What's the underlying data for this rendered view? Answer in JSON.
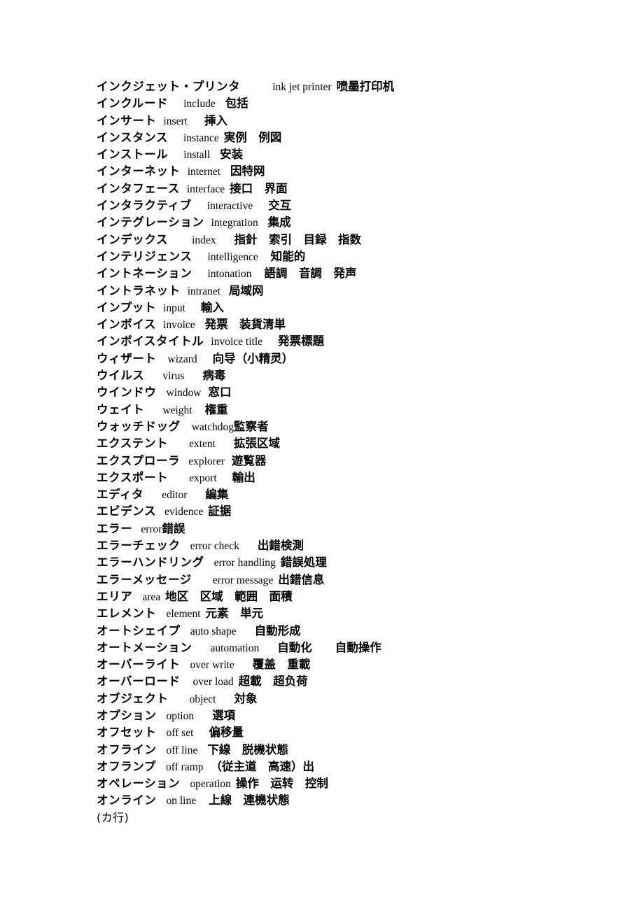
{
  "document": {
    "page_background": "#ffffff",
    "text_color": "#000000",
    "script_kind": "katakana-glossary",
    "columns": [
      "katakana",
      "english",
      "chinese_glosses"
    ]
  },
  "entries": [
    {
      "jp": "インクジェット・プリンタ",
      "gap1": 46,
      "en": "ink jet printer",
      "gap2": 7,
      "cn": "喷墨打印机"
    },
    {
      "jp": "インクルード",
      "gap1": 22,
      "en": "include",
      "gap2": 14,
      "cn": "包括"
    },
    {
      "jp": "インサート",
      "gap1": 10,
      "en": "insert",
      "gap2": 24,
      "cn": "挿入"
    },
    {
      "jp": "インスタンス",
      "gap1": 22,
      "en": "instance",
      "gap2": 7,
      "cn": "実例　例図"
    },
    {
      "jp": "インストール",
      "gap1": 22,
      "en": "install",
      "gap2": 14,
      "cn": "安装"
    },
    {
      "jp": "インターネット",
      "gap1": 10,
      "en": "internet",
      "gap2": 14,
      "cn": "因特网"
    },
    {
      "jp": "インタフェース",
      "gap1": 10,
      "en": "interface",
      "gap2": 7,
      "cn": "接口　界面"
    },
    {
      "jp": "インタラクティブ",
      "gap1": 22,
      "en": "interactive",
      "gap2": 22,
      "cn": "交互"
    },
    {
      "jp": "インテグレーション",
      "gap1": 10,
      "en": "integration",
      "gap2": 14,
      "cn": "集成"
    },
    {
      "jp": "インデックス",
      "gap1": 34,
      "en": "index",
      "gap2": 26,
      "cn": "指針　索引　目録　指数"
    },
    {
      "jp": "インテリジェンス",
      "gap1": 22,
      "en": "intelligence",
      "gap2": 18,
      "cn": "知能的"
    },
    {
      "jp": "イントネーション",
      "gap1": 22,
      "en": "intonation",
      "gap2": 18,
      "cn": "語調　音調　発声"
    },
    {
      "jp": "イントラネット",
      "gap1": 10,
      "en": "intranet",
      "gap2": 12,
      "cn": "局域网"
    },
    {
      "jp": "インプット",
      "gap1": 10,
      "en": "input",
      "gap2": 22,
      "cn": "輸入"
    },
    {
      "jp": "インボイス",
      "gap1": 10,
      "en": "invoice",
      "gap2": 14,
      "cn": "発票　装貨清単"
    },
    {
      "jp": "インボイスタイトル",
      "gap1": 10,
      "en": "invoice title",
      "gap2": 22,
      "cn": "発票標題"
    },
    {
      "jp": "ウィザート",
      "gap1": 16,
      "en": "wizard",
      "gap2": 22,
      "cn": "向导（小精灵）"
    },
    {
      "jp": "ウイルス",
      "gap1": 26,
      "en": "virus",
      "gap2": 26,
      "cn": "病毒"
    },
    {
      "jp": "ウインドウ",
      "gap1": 14,
      "en": "window",
      "gap2": 10,
      "cn": "窓口"
    },
    {
      "jp": "ウェイト",
      "gap1": 26,
      "en": "weight",
      "gap2": 18,
      "cn": "権重"
    },
    {
      "jp": "ウォッチドッグ",
      "gap1": 16,
      "en": "watchdog",
      "gap2": 0,
      "cn": "監察者"
    },
    {
      "jp": "エクステント",
      "gap1": 30,
      "en": "extent",
      "gap2": 26,
      "cn": "拡張区域"
    },
    {
      "jp": "エクスプローラ",
      "gap1": 12,
      "en": "explorer",
      "gap2": 10,
      "cn": "遊覧器"
    },
    {
      "jp": "エクスポート",
      "gap1": 30,
      "en": "export",
      "gap2": 22,
      "cn": "輸出"
    },
    {
      "jp": "エディタ",
      "gap1": 26,
      "en": "editor",
      "gap2": 26,
      "cn": "編集"
    },
    {
      "jp": "エビデンス",
      "gap1": 12,
      "en": "evidence",
      "gap2": 7,
      "cn": "証据"
    },
    {
      "jp": "エラー",
      "gap1": 12,
      "en": "error",
      "gap2": 0,
      "cn": "錯誤"
    },
    {
      "jp": "エラーチェック",
      "gap1": 14,
      "en": "error check",
      "gap2": 26,
      "cn": "出錯検測"
    },
    {
      "jp": "エラーハンドリング",
      "gap1": 14,
      "en": "error handling",
      "gap2": 7,
      "cn": "錯誤処理"
    },
    {
      "jp": "エラーメッセージ",
      "gap1": 30,
      "en": "error message",
      "gap2": 7,
      "cn": "出錯信息"
    },
    {
      "jp": "エリア",
      "gap1": 14,
      "en": "area",
      "gap2": 7,
      "cn": "地区　区域　範囲　面積"
    },
    {
      "jp": "エレメント",
      "gap1": 14,
      "en": "element",
      "gap2": 7,
      "cn": "元素　単元"
    },
    {
      "jp": "オートシェイプ",
      "gap1": 14,
      "en": "auto shape",
      "gap2": 26,
      "cn": "自動形成"
    },
    {
      "jp": "オートメーション",
      "gap1": 26,
      "en": "automation",
      "gap2": 26,
      "cn": "自動化　　自動操作"
    },
    {
      "jp": "オーバーライト",
      "gap1": 14,
      "en": "over write",
      "gap2": 26,
      "cn": "覆盖　重載"
    },
    {
      "jp": "オーバーロード",
      "gap1": 18,
      "en": "over load",
      "gap2": 7,
      "cn": "超載　超负荷"
    },
    {
      "jp": "オブジェクト",
      "gap1": 30,
      "en": "object",
      "gap2": 26,
      "cn": "対象"
    },
    {
      "jp": "オプション",
      "gap1": 14,
      "en": "option",
      "gap2": 26,
      "cn": "選項"
    },
    {
      "jp": "オフセット",
      "gap1": 14,
      "en": "off set",
      "gap2": 22,
      "cn": "偏移量"
    },
    {
      "jp": "オフライン",
      "gap1": 14,
      "en": "off line",
      "gap2": 14,
      "cn": "下線　脱機状態"
    },
    {
      "jp": "オフランプ",
      "gap1": 14,
      "en": "off ramp",
      "gap2": 10,
      "cn": "（従主道　高速）出"
    },
    {
      "jp": "オペレーション",
      "gap1": 14,
      "en": "operation",
      "gap2": 7,
      "cn": "操作　运转　控制"
    },
    {
      "jp": "オンライン",
      "gap1": 14,
      "en": "on line",
      "gap2": 18,
      "cn": "上線　連機状態"
    }
  ],
  "section_marker": {
    "label": "(カ行)"
  }
}
